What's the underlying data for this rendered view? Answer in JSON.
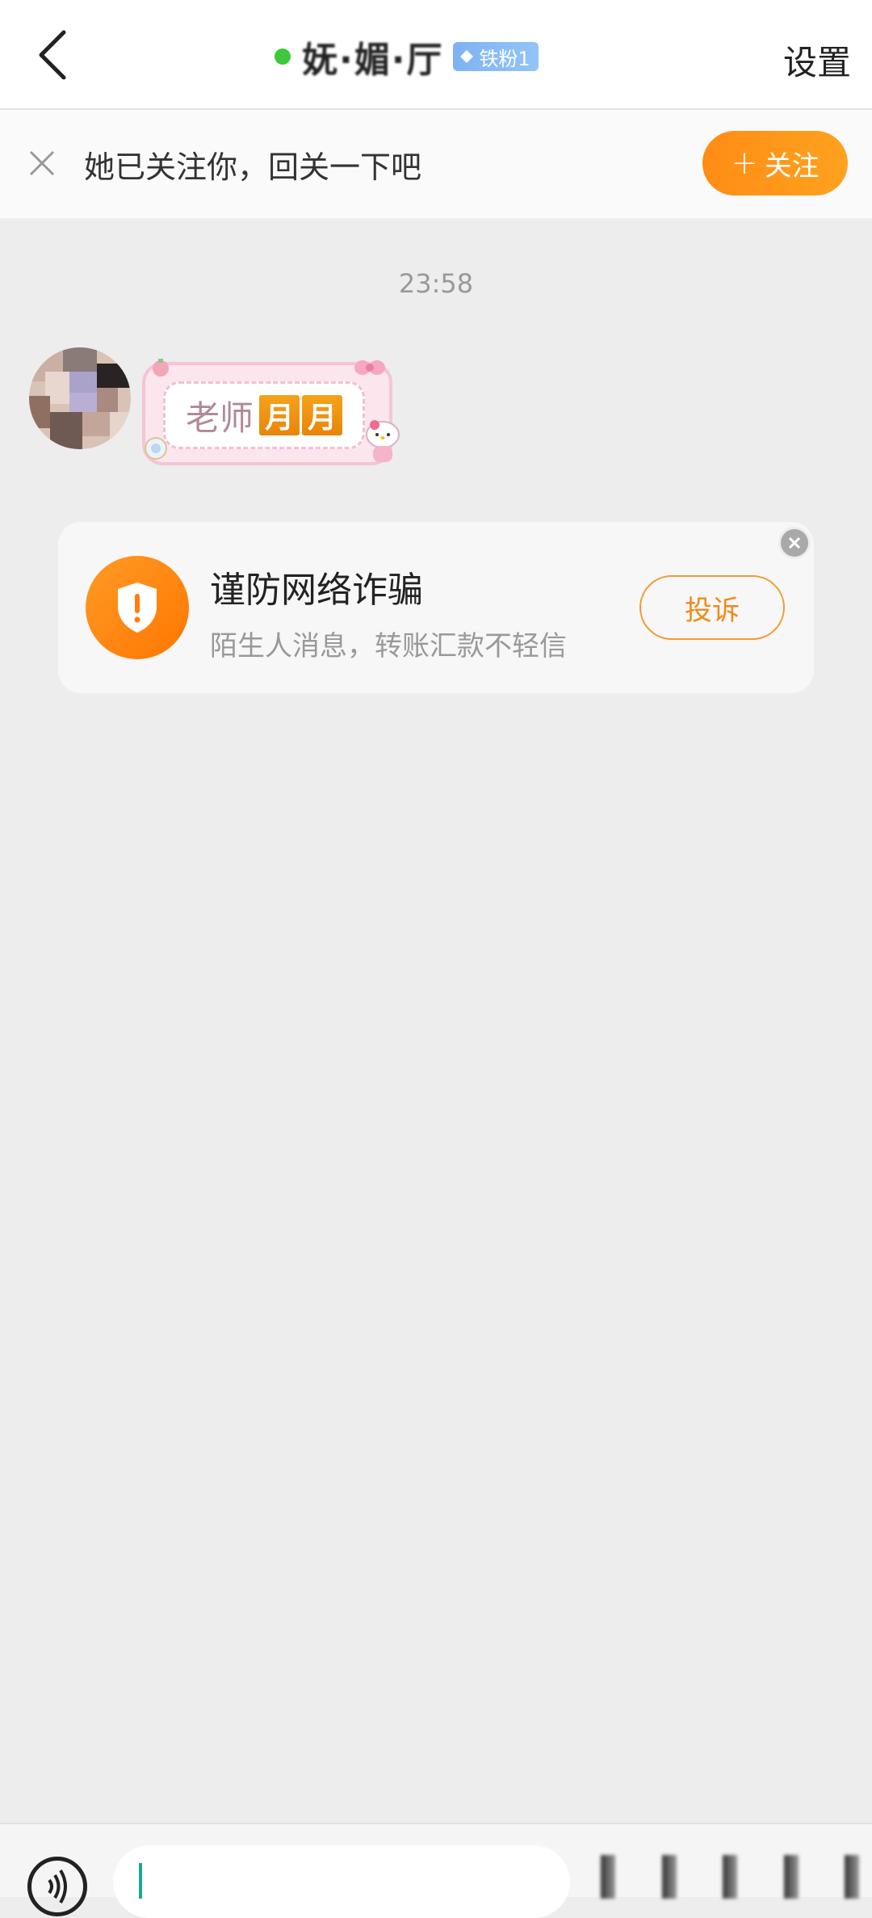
{
  "header": {
    "title": "妩·媚·厅",
    "badge_label": "铁粉1",
    "settings_label": "设置",
    "online_color": "#3ec83a"
  },
  "follow_banner": {
    "text": "她已关注你，回关一下吧",
    "follow_label": "关注",
    "plus_icon": "plus-icon"
  },
  "chat": {
    "timestamp": "23:58",
    "sticker": {
      "text": "老师",
      "boxes": [
        "月",
        "月"
      ]
    }
  },
  "warning": {
    "title": "谨防网络诈骗",
    "subtitle": "陌生人消息，转账汇款不轻信",
    "report_label": "投诉",
    "accent_color": "#ff8a12"
  }
}
